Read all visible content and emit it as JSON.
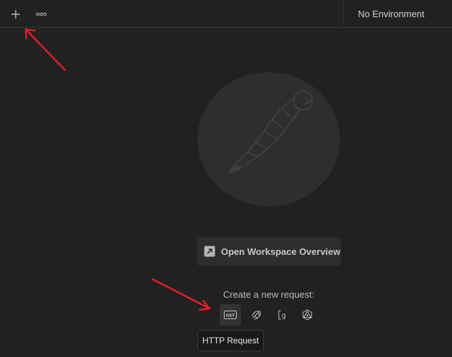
{
  "topbar": {
    "new_tab_icon": "plus-icon",
    "more_icon": "ellipsis-icon",
    "environment_label": "No Environment"
  },
  "empty_state": {
    "logo_icon": "postman-astronaut-logo",
    "overview_button_label": "Open Workspace Overview",
    "overview_button_icon": "open-external-icon",
    "create_label": "Create a new request:",
    "request_types": [
      {
        "name": "HTTP Request",
        "icon": "get-icon"
      },
      {
        "name": "WebSocket Request",
        "icon": "websocket-icon"
      },
      {
        "name": "GraphQL Request",
        "icon": "graphql-g-icon"
      },
      {
        "name": "gRPC Request",
        "icon": "grpc-icon"
      }
    ],
    "tooltip": "HTTP Request"
  },
  "colors": {
    "background": "#212121",
    "annotation_arrow": "#e0202c"
  }
}
